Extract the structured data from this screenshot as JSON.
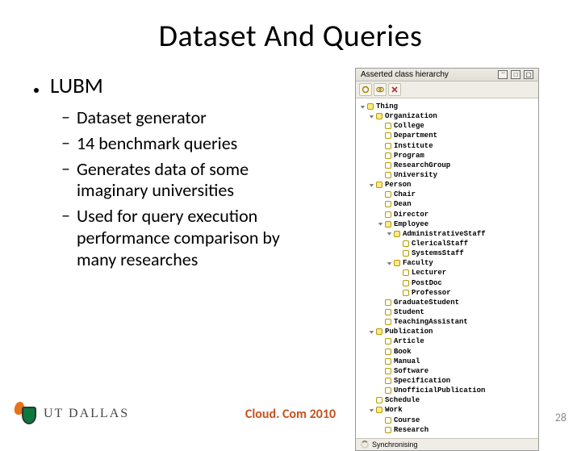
{
  "title": "Dataset And Queries",
  "main_bullet": "LUBM",
  "subs": {
    "s0": "Dataset generator",
    "s1": "14 benchmark queries",
    "s2": "Generates data of some imaginary universities",
    "s3": "Used for query execution performance comparison by many researches"
  },
  "panel": {
    "header": "Asserted class hierarchy",
    "status": "Synchronising",
    "tree": {
      "root": "Thing",
      "l1": {
        "n0": "Organization",
        "n0c": {
          "c0": "College",
          "c1": "Department",
          "c2": "Institute",
          "c3": "Program",
          "c4": "ResearchGroup",
          "c5": "University"
        },
        "n1": "Person",
        "n1c": {
          "c0": "Chair",
          "c1": "Dean",
          "c2": "Director",
          "c3": "Employee",
          "c3c": {
            "d0": "AdministrativeStaff",
            "d0c": {
              "e0": "ClericalStaff",
              "e1": "SystemsStaff"
            },
            "d1": "Faculty",
            "d1c": {
              "e0": "Lecturer",
              "e1": "PostDoc",
              "e2": "Professor"
            }
          },
          "c4": "GraduateStudent",
          "c5": "Student",
          "c6": "TeachingAssistant"
        },
        "n2": "Publication",
        "n2c": {
          "c0": "Article",
          "c1": "Book",
          "c2": "Manual",
          "c3": "Software",
          "c4": "Specification",
          "c5": "UnofficialPublication"
        },
        "n3": "Schedule",
        "n4": "Work",
        "n4c": {
          "c0": "Course",
          "c1": "Research"
        }
      }
    }
  },
  "footer": {
    "logo_text": "UT DALLAS",
    "center": "Cloud. Com 2010",
    "page": "28"
  }
}
